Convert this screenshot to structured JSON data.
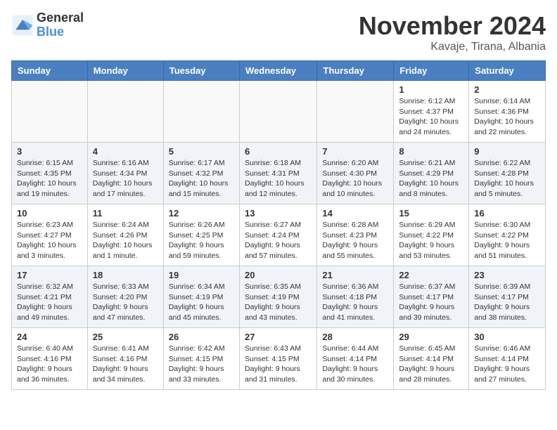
{
  "header": {
    "logo": {
      "general": "General",
      "blue": "Blue"
    },
    "title": "November 2024",
    "location": "Kavaje, Tirana, Albania"
  },
  "calendar": {
    "days_of_week": [
      "Sunday",
      "Monday",
      "Tuesday",
      "Wednesday",
      "Thursday",
      "Friday",
      "Saturday"
    ],
    "weeks": [
      [
        {
          "day": "",
          "info": ""
        },
        {
          "day": "",
          "info": ""
        },
        {
          "day": "",
          "info": ""
        },
        {
          "day": "",
          "info": ""
        },
        {
          "day": "",
          "info": ""
        },
        {
          "day": "1",
          "info": "Sunrise: 6:12 AM\nSunset: 4:37 PM\nDaylight: 10 hours and 24 minutes."
        },
        {
          "day": "2",
          "info": "Sunrise: 6:14 AM\nSunset: 4:36 PM\nDaylight: 10 hours and 22 minutes."
        }
      ],
      [
        {
          "day": "3",
          "info": "Sunrise: 6:15 AM\nSunset: 4:35 PM\nDaylight: 10 hours and 19 minutes."
        },
        {
          "day": "4",
          "info": "Sunrise: 6:16 AM\nSunset: 4:34 PM\nDaylight: 10 hours and 17 minutes."
        },
        {
          "day": "5",
          "info": "Sunrise: 6:17 AM\nSunset: 4:32 PM\nDaylight: 10 hours and 15 minutes."
        },
        {
          "day": "6",
          "info": "Sunrise: 6:18 AM\nSunset: 4:31 PM\nDaylight: 10 hours and 12 minutes."
        },
        {
          "day": "7",
          "info": "Sunrise: 6:20 AM\nSunset: 4:30 PM\nDaylight: 10 hours and 10 minutes."
        },
        {
          "day": "8",
          "info": "Sunrise: 6:21 AM\nSunset: 4:29 PM\nDaylight: 10 hours and 8 minutes."
        },
        {
          "day": "9",
          "info": "Sunrise: 6:22 AM\nSunset: 4:28 PM\nDaylight: 10 hours and 5 minutes."
        }
      ],
      [
        {
          "day": "10",
          "info": "Sunrise: 6:23 AM\nSunset: 4:27 PM\nDaylight: 10 hours and 3 minutes."
        },
        {
          "day": "11",
          "info": "Sunrise: 6:24 AM\nSunset: 4:26 PM\nDaylight: 10 hours and 1 minute."
        },
        {
          "day": "12",
          "info": "Sunrise: 6:26 AM\nSunset: 4:25 PM\nDaylight: 9 hours and 59 minutes."
        },
        {
          "day": "13",
          "info": "Sunrise: 6:27 AM\nSunset: 4:24 PM\nDaylight: 9 hours and 57 minutes."
        },
        {
          "day": "14",
          "info": "Sunrise: 6:28 AM\nSunset: 4:23 PM\nDaylight: 9 hours and 55 minutes."
        },
        {
          "day": "15",
          "info": "Sunrise: 6:29 AM\nSunset: 4:22 PM\nDaylight: 9 hours and 53 minutes."
        },
        {
          "day": "16",
          "info": "Sunrise: 6:30 AM\nSunset: 4:22 PM\nDaylight: 9 hours and 51 minutes."
        }
      ],
      [
        {
          "day": "17",
          "info": "Sunrise: 6:32 AM\nSunset: 4:21 PM\nDaylight: 9 hours and 49 minutes."
        },
        {
          "day": "18",
          "info": "Sunrise: 6:33 AM\nSunset: 4:20 PM\nDaylight: 9 hours and 47 minutes."
        },
        {
          "day": "19",
          "info": "Sunrise: 6:34 AM\nSunset: 4:19 PM\nDaylight: 9 hours and 45 minutes."
        },
        {
          "day": "20",
          "info": "Sunrise: 6:35 AM\nSunset: 4:19 PM\nDaylight: 9 hours and 43 minutes."
        },
        {
          "day": "21",
          "info": "Sunrise: 6:36 AM\nSunset: 4:18 PM\nDaylight: 9 hours and 41 minutes."
        },
        {
          "day": "22",
          "info": "Sunrise: 6:37 AM\nSunset: 4:17 PM\nDaylight: 9 hours and 39 minutes."
        },
        {
          "day": "23",
          "info": "Sunrise: 6:39 AM\nSunset: 4:17 PM\nDaylight: 9 hours and 38 minutes."
        }
      ],
      [
        {
          "day": "24",
          "info": "Sunrise: 6:40 AM\nSunset: 4:16 PM\nDaylight: 9 hours and 36 minutes."
        },
        {
          "day": "25",
          "info": "Sunrise: 6:41 AM\nSunset: 4:16 PM\nDaylight: 9 hours and 34 minutes."
        },
        {
          "day": "26",
          "info": "Sunrise: 6:42 AM\nSunset: 4:15 PM\nDaylight: 9 hours and 33 minutes."
        },
        {
          "day": "27",
          "info": "Sunrise: 6:43 AM\nSunset: 4:15 PM\nDaylight: 9 hours and 31 minutes."
        },
        {
          "day": "28",
          "info": "Sunrise: 6:44 AM\nSunset: 4:14 PM\nDaylight: 9 hours and 30 minutes."
        },
        {
          "day": "29",
          "info": "Sunrise: 6:45 AM\nSunset: 4:14 PM\nDaylight: 9 hours and 28 minutes."
        },
        {
          "day": "30",
          "info": "Sunrise: 6:46 AM\nSunset: 4:14 PM\nDaylight: 9 hours and 27 minutes."
        }
      ]
    ]
  }
}
